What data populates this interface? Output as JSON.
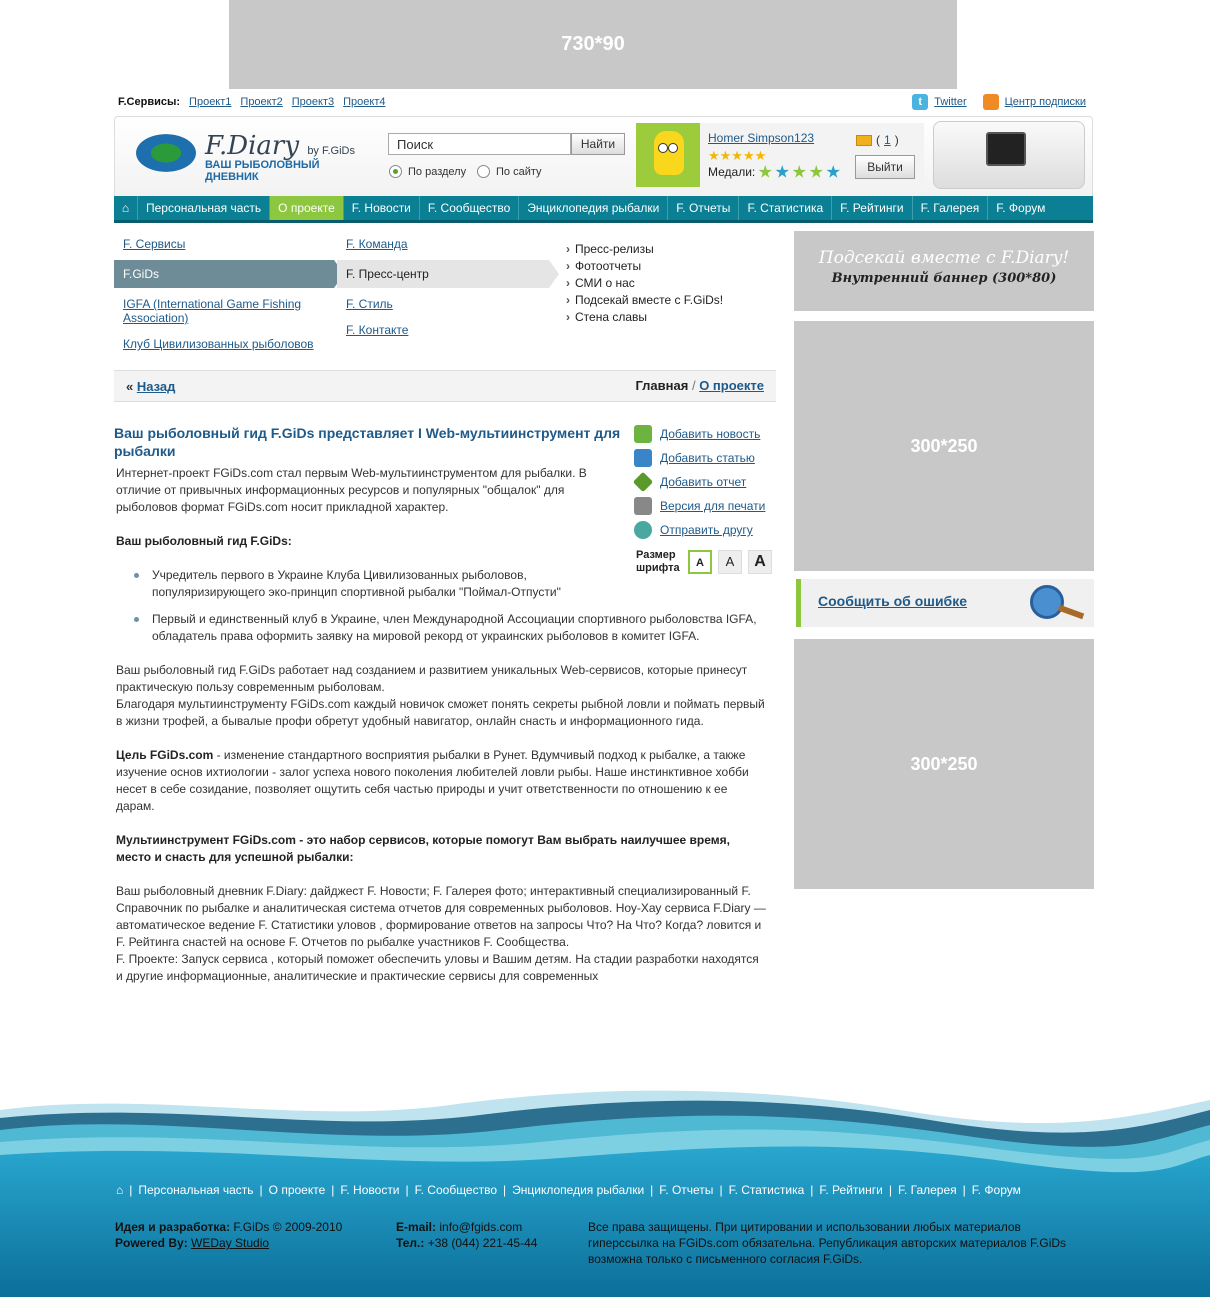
{
  "top_banner": "730*90",
  "services": {
    "label": "F.Сервисы:",
    "links": [
      "Проект1",
      "Проект2",
      "Проект3",
      "Проект4"
    ]
  },
  "subscribe": {
    "twitter": "Twitter",
    "center": "Центр подписки"
  },
  "logo": {
    "title": "F.Diary",
    "by": "by F.GiDs",
    "tagline": "ВАШ РЫБОЛОВНЫЙ ДНЕВНИК"
  },
  "search": {
    "value": "Поиск",
    "button": "Найти",
    "scope_section": "По разделу",
    "scope_site": "По сайту"
  },
  "user": {
    "name": "Homer Simpson123",
    "stars": "★★★★★",
    "medals_label": "Медали:",
    "messages": "1",
    "logout": "Выйти",
    "medal_colors": [
      "#8dc63f",
      "#2aa0c8",
      "#8dc63f",
      "#8dc63f",
      "#2aa0c8"
    ]
  },
  "nav": {
    "items": [
      "Персональная часть",
      "О проекте",
      "F. Новости",
      "F. Сообщество",
      "Энциклопедия рыбалки",
      "F. Отчеты",
      "F. Статистика",
      "F. Рейтинги",
      "F. Галерея",
      "F. Форум"
    ],
    "active": "О проекте"
  },
  "submenu": {
    "col1": [
      "F. Сервисы",
      "F.GiDs",
      "IGFA (International Game Fishing Association)",
      "Клуб Цивилизованных рыболовов"
    ],
    "col2": [
      "F. Команда",
      "F. Пресс-центр",
      "F. Стиль",
      "F. Контакте"
    ],
    "col3": [
      "Пресс-релизы",
      "Фотоотчеты",
      "СМИ о нас",
      "Подсекай вместе с F.GiDs!",
      "Стена славы"
    ]
  },
  "crumbs": {
    "back": "Назад",
    "home": "Главная",
    "current": "О проекте",
    "sep": "/",
    "back_mark": "«"
  },
  "article": {
    "title": "Ваш рыболовный гид F.GiDs представляет I Web-мультиинструмент для рыбалки",
    "intro": "Интернет-проект FGiDs.com стал первым Web-мультиинструментом для рыбалки. В отличие от привычных информационных ресурсов и популярных \"общалок\" для рыболовов формат FGiDs.com носит прикладной характер.",
    "sub1": "Ваш рыболовный гид F.GiDs:",
    "bullets": [
      "Учредитель первого в Украине  Клуба Цивилизованных рыболовов, популяризирующего эко-принцип спортивной рыбалки \"Поймал-Отпусти\"",
      "Первый и единственный клуб в Украине, член Международной Ассоциации спортивного рыболовства IGFA, обладатель права оформить заявку на мировой рекорд от украинских рыболовов в комитет IGFA."
    ],
    "p2": "Ваш рыболовный гид F.GiDs работает над созданием и развитием уникальных Web-сервисов, которые принесут практическую пользу современным рыболовам.",
    "p3": "Благодаря мультиинструменту FGiDs.com каждый новичок сможет понять секреты рыбной ловли и поймать первый в жизни трофей, а бывалые профи обретут удобный навигатор, онлайн снасть и информационного гида.",
    "goal_b": "Цель FGiDs.com",
    "goal": " - изменение стандартного восприятия рыбалки в Рунет. Вдумчивый подход к рыбалке, а также изучение основ ихтиологии - залог успеха нового поколения любителей ловли рыбы. Наше инстинктивное хобби несет в себе созидание, позволяет ощутить себя частью природы и учит ответственности по отношению к ее дарам.",
    "multi": "Мультиинструмент FGiDs.com - это набор сервисов, которые помогут Вам выбрать наилучшее время, место и снасть для успешной рыбалки:",
    "p4": "Ваш рыболовный дневник F.Diary: дайджест F. Новости; F. Галерея фото; интерактивный специализированный F. Справочник по рыбалке и аналитическая система отчетов для современных рыболовов. Ноу-Хау сервиса F.Diary — автоматическое ведение F. Статистики уловов , формирование ответов на запросы Что? На Что? Когда? ловится и F. Рейтинга снастей на основе F. Отчетов по рыбалке участников F. Сообщества.",
    "p5": "F. Проекте: Запуск сервиса , который поможет обеспечить уловы и Вашим детям. На стадии разработки находятся и другие информационные, аналитические и практические сервисы для современных"
  },
  "tools": {
    "items": [
      "Добавить новость",
      "Добавить статью",
      "Добавить отчет",
      "Версия для печати",
      "Отправить другу"
    ],
    "font_label": "Размер шрифта",
    "font_sizes": [
      "A",
      "A",
      "A"
    ]
  },
  "right": {
    "banner_a": "Подсекай вместе с F.Diary!",
    "banner_b": "Внутренний баннер (300*80)",
    "ad1": "300*250",
    "ad2": "300*250",
    "report": "Сообщить об ошибке"
  },
  "footer": {
    "nav": [
      "Персональная часть",
      "О проекте",
      "F. Новости",
      "F. Сообщество",
      "Энциклопедия рыбалки",
      "F. Отчеты",
      "F. Статистика",
      "F. Рейтинги",
      "F. Галерея",
      "F. Форум"
    ],
    "idea_label": "Идея и разработка:",
    "idea": " F.GiDs ©  2009-2010",
    "powered_label": "Powered By:",
    "powered": "WEDay Studio",
    "email_label": "E-mail:",
    "email": " info@fgids.com",
    "tel_label": "Тел.:",
    "tel": " +38 (044) 221-45-44",
    "rights": "Все права защищены. При цитировании и использовании любых материалов гиперссылка на FGiDs.com обязательна. Републикация авторских материалов F.GiDs возможна только с письменного согласия F.GiDs."
  }
}
